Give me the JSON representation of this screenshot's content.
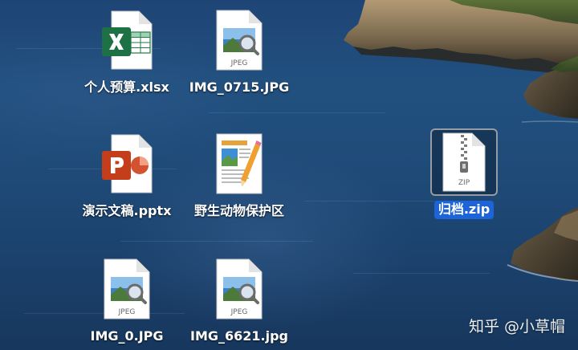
{
  "desktop": {
    "files": [
      {
        "name": "个人预算.xlsx",
        "type": "excel",
        "icon": "excel-spreadsheet-icon",
        "selected": false
      },
      {
        "name": "IMG_0715.JPG",
        "type": "jpeg",
        "icon": "jpeg-image-icon",
        "badge": "JPEG",
        "selected": false
      },
      {
        "name": "演示文稿.pptx",
        "type": "powerpoint",
        "icon": "powerpoint-presentation-icon",
        "selected": false
      },
      {
        "name": "野生动物保护区",
        "type": "pages",
        "icon": "pages-document-icon",
        "selected": false
      },
      {
        "name": "归档.zip",
        "type": "zip",
        "icon": "zip-archive-icon",
        "badge": "ZIP",
        "selected": true
      },
      {
        "name": "IMG_0.JPG",
        "type": "jpeg",
        "icon": "jpeg-image-icon",
        "badge": "JPEG",
        "selected": false
      },
      {
        "name": "IMG_6621.jpg",
        "type": "jpeg",
        "icon": "jpeg-image-icon",
        "badge": "JPEG",
        "selected": false
      }
    ],
    "selection_color": "#1d64d8"
  },
  "watermark": {
    "text": "知乎 @小草帽"
  }
}
